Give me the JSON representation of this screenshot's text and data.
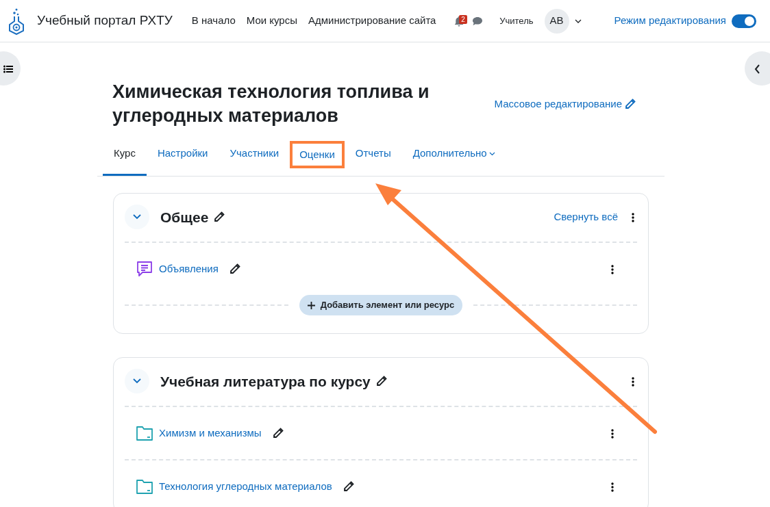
{
  "navbar": {
    "site_name": "Учебный портал РХТУ",
    "links": [
      "В начало",
      "Мои курсы",
      "Администрирование сайта"
    ],
    "notification_count": "2",
    "role": "Учитель",
    "avatar_initials": "AB",
    "edit_mode": {
      "label": "Режим редактирования",
      "on": true
    }
  },
  "course": {
    "title": "Химическая технология топлива и углеродных материалов",
    "bulk_edit": "Массовое редактирование"
  },
  "tabs": [
    {
      "label": "Курс",
      "selected": true,
      "highlighted": false,
      "dropdown": false
    },
    {
      "label": "Настройки",
      "selected": false,
      "highlighted": false,
      "dropdown": false
    },
    {
      "label": "Участники",
      "selected": false,
      "highlighted": false,
      "dropdown": false
    },
    {
      "label": "Оценки",
      "selected": false,
      "highlighted": true,
      "dropdown": false
    },
    {
      "label": "Отчеты",
      "selected": false,
      "highlighted": false,
      "dropdown": false
    },
    {
      "label": "Дополнительно",
      "selected": false,
      "highlighted": false,
      "dropdown": true
    }
  ],
  "sections": [
    {
      "title": "Общее",
      "expanded": true,
      "collapse_all": "Свернуть всё",
      "activities": [
        {
          "kind": "forum",
          "name": "Объявления"
        }
      ],
      "add_button": "Добавить элемент или ресурс"
    },
    {
      "title": "Учебная литература по курсу",
      "expanded": true,
      "activities": [
        {
          "kind": "folder",
          "name": "Химизм и механизмы"
        },
        {
          "kind": "folder",
          "name": "Технология углеродных материалов"
        }
      ]
    }
  ],
  "annotation": {
    "arrow": true
  }
}
